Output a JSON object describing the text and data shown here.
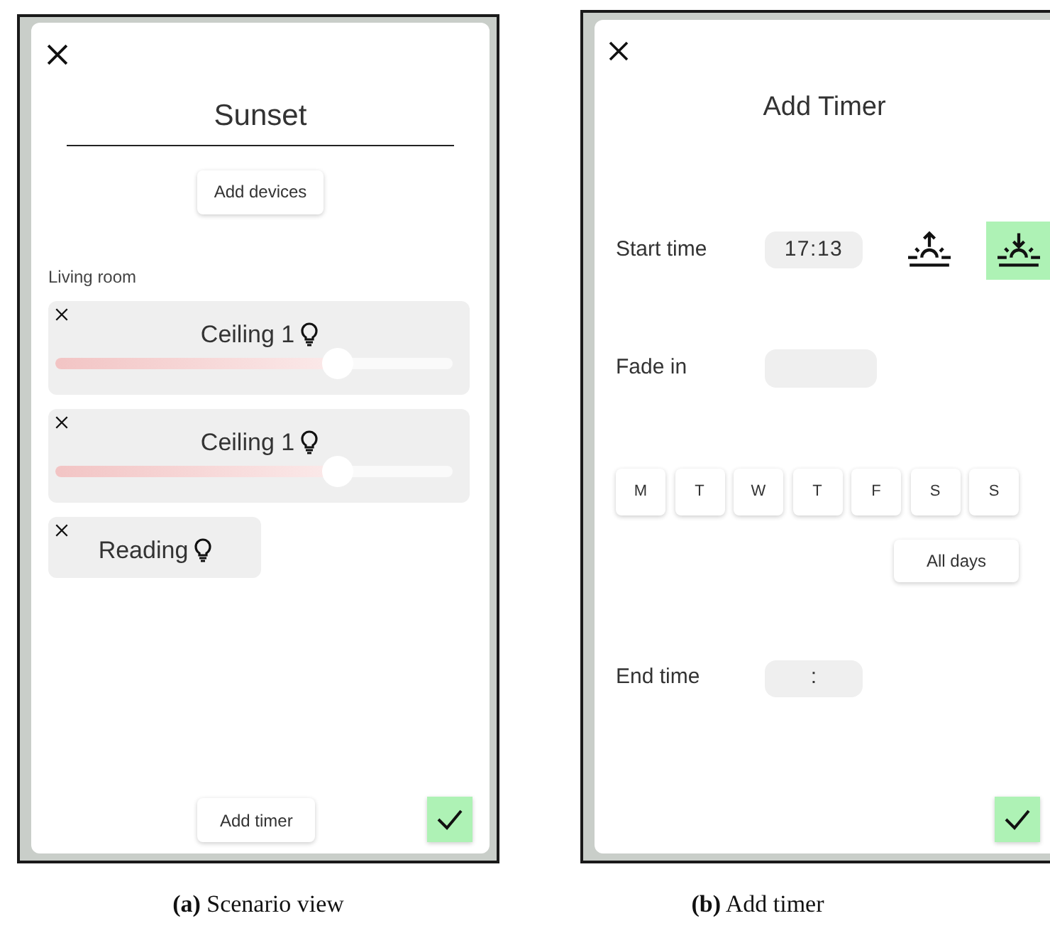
{
  "scenario_view": {
    "title": "Sunset",
    "add_devices": "Add devices",
    "rooms": [
      {
        "name": "Living room",
        "devices": [
          {
            "kind": "dimmable",
            "name": "Ceiling 1",
            "level": 0.71
          },
          {
            "kind": "dimmable",
            "name": "Ceiling 1",
            "level": 0.71
          },
          {
            "kind": "switch",
            "name": "Reading"
          }
        ]
      }
    ],
    "add_timer": "Add timer"
  },
  "add_timer": {
    "title": "Add Timer",
    "start_time": {
      "label": "Start time",
      "value": "17:13",
      "modes": [
        {
          "kind": "sunrise",
          "selected": false
        },
        {
          "kind": "sunset",
          "selected": true
        }
      ]
    },
    "fade_in": {
      "label": "Fade in"
    },
    "days": [
      {
        "label": "M",
        "selected": false
      },
      {
        "label": "T",
        "selected": false
      },
      {
        "label": "W",
        "selected": false
      },
      {
        "label": "T",
        "selected": false
      },
      {
        "label": "F",
        "selected": false
      },
      {
        "label": "S",
        "selected": false
      },
      {
        "label": "S",
        "selected": false
      }
    ],
    "all_days": "All days",
    "end_time": {
      "label": "End time",
      "value": ":"
    }
  },
  "captions": [
    "**(a)** Scenario view",
    "**(b)** Add timer"
  ]
}
